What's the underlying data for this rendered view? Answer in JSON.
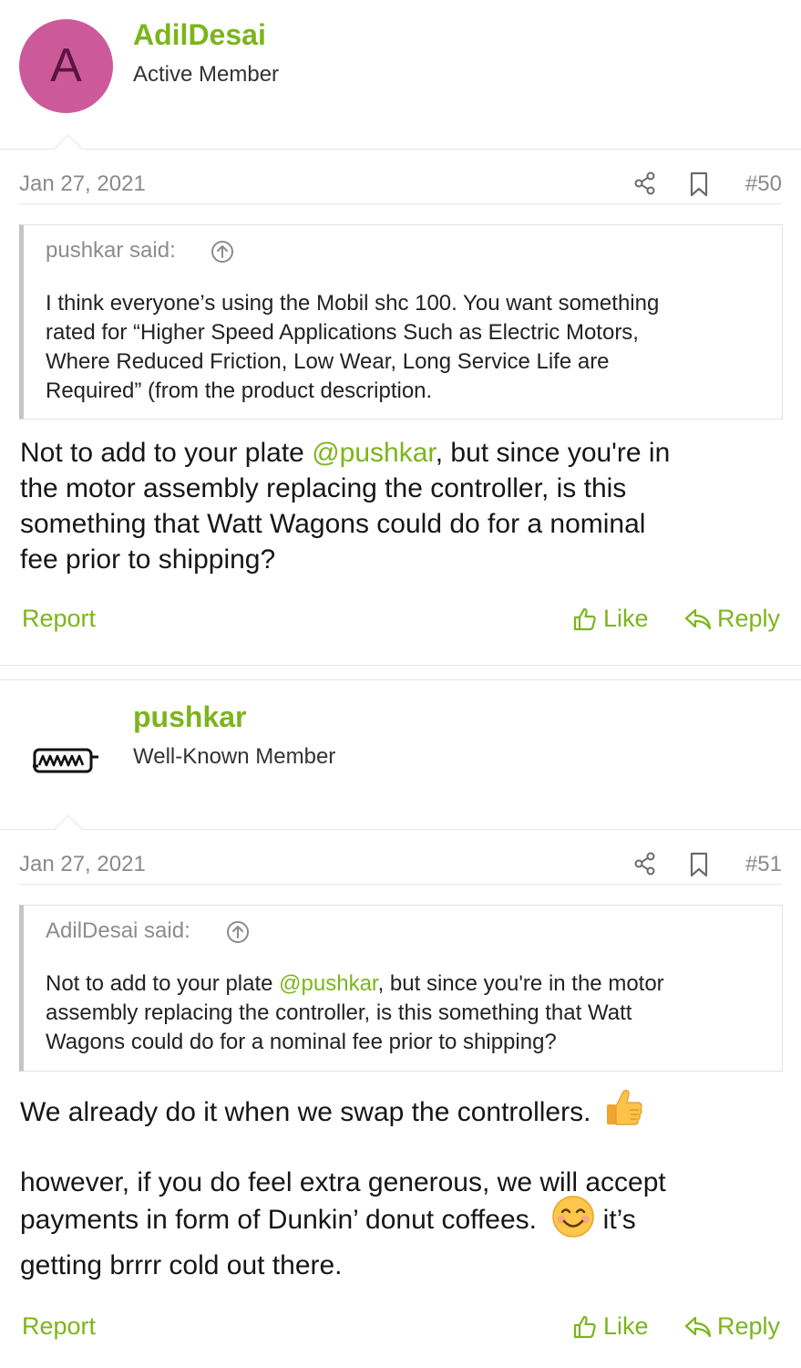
{
  "posts": [
    {
      "username": "AdilDesai",
      "user_title": "Active Member",
      "avatar_letter": "A",
      "date": "Jan 27, 2021",
      "post_number": "#50",
      "quote_author": "pushkar said:",
      "quote_lines": [
        "I think everyone’s using the Mobil shc 100. You want something",
        "rated for “Higher Speed Applications Such as Electric Motors,",
        "Where Reduced Friction, Low Wear, Long Service Life are",
        "Required” (from the product description."
      ],
      "message": {
        "line1_pre": "Not to add to your plate ",
        "line1_mention": "@pushkar",
        "line1_post": ", but since you're in",
        "line2": "the motor assembly replacing the controller, is this",
        "line3": "something that Watt Wagons could do for a nominal",
        "line4": "fee prior to shipping?"
      },
      "actions": {
        "report": "Report",
        "like": "Like",
        "reply": "Reply"
      }
    },
    {
      "username": "pushkar",
      "user_title": "Well-Known Member",
      "date": "Jan 27, 2021",
      "post_number": "#51",
      "quote_author": "AdilDesai said:",
      "quote_line1_pre": "Not to add to your plate ",
      "quote_line1_mention": "@pushkar",
      "quote_line1_post": ", but since you're in the motor",
      "quote_line2": "assembly replacing the controller, is this something that Watt",
      "quote_line3": "Wagons could do for a nominal fee prior to shipping?",
      "message": {
        "para1": "We already do it when we swap the controllers.",
        "para2_line1": "however, if you do feel extra generous, we will accept",
        "para2_line2": "payments in form of Dunkin’ donut coffees.",
        "para2_line2_post": " it’s",
        "para2_line3": "getting brrrr cold out there."
      },
      "actions": {
        "report": "Report",
        "like": "Like",
        "reply": "Reply"
      }
    }
  ],
  "icons": [
    "share-icon",
    "bookmark-icon",
    "arrow-up-circle-icon",
    "thumbs-up-icon",
    "reply-icon",
    "thumbs-up-emoji",
    "smile-emoji"
  ],
  "colors": {
    "accent": "#7cb51c",
    "avatar": "#cc5a9a",
    "muted": "#8a8a8a"
  }
}
